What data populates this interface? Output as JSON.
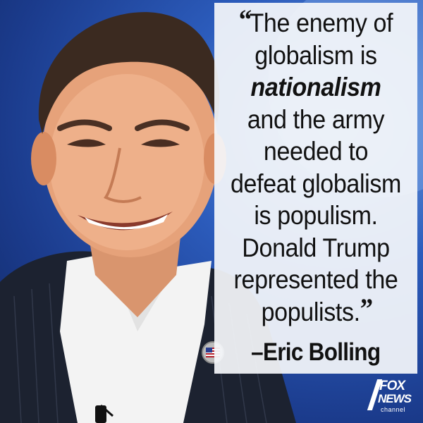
{
  "quote": {
    "open_mark": "“",
    "lines": [
      "The enemy of",
      "globalism is",
      "nationalism",
      "and the army",
      "needed to",
      "defeat globalism",
      "is populism.",
      "Donald Trump",
      "represented the",
      "populists."
    ],
    "close_mark": "”",
    "attribution": "–Eric Bolling"
  },
  "logo": {
    "line1": "FOX",
    "line2": "NEWS",
    "line3": "channel"
  },
  "colors": {
    "background_blue": "#2c5cbc",
    "panel": "#f4f6fa",
    "text": "#111111"
  },
  "icons": [
    "flag-pin-icon",
    "microphone-icon",
    "network-logo"
  ]
}
